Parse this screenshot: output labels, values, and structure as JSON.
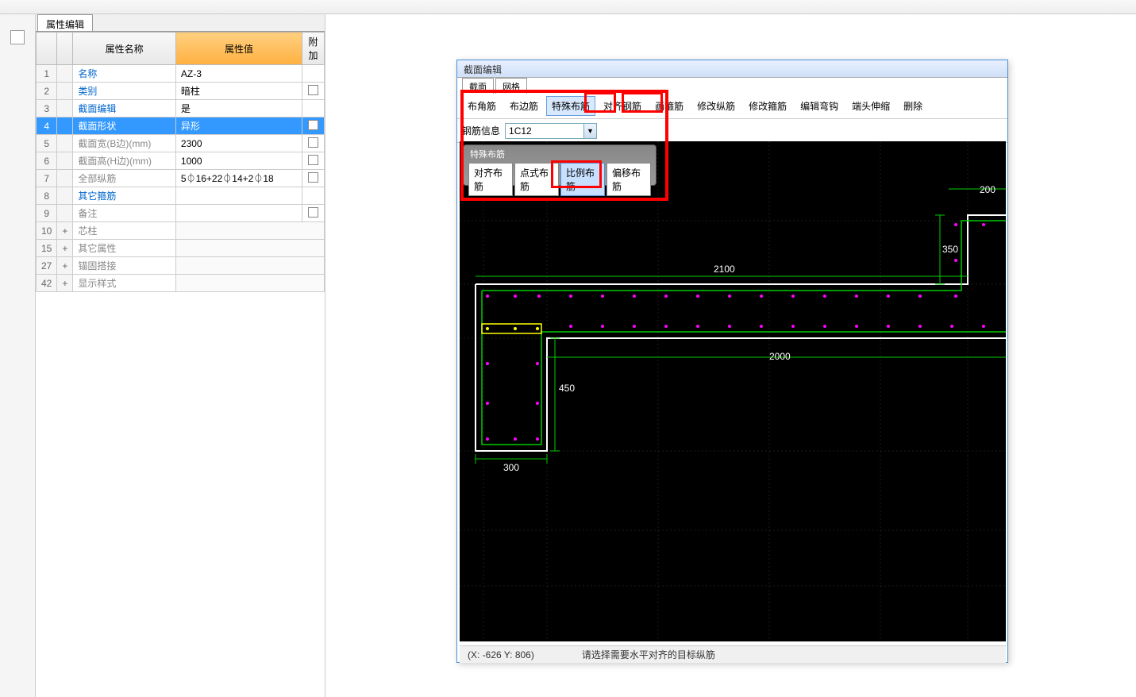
{
  "panel_tab": "属性编辑",
  "columns": {
    "name": "属性名称",
    "value": "属性值",
    "extra": "附加"
  },
  "rows": [
    {
      "num": "1",
      "name": "名称",
      "value": "AZ-3",
      "cls": "name",
      "check": false
    },
    {
      "num": "2",
      "name": "类别",
      "value": "暗柱",
      "cls": "name",
      "check": true
    },
    {
      "num": "3",
      "name": "截面编辑",
      "value": "是",
      "cls": "name",
      "check": false
    },
    {
      "num": "4",
      "name": "截面形状",
      "value": "异形",
      "cls": "name",
      "check": true,
      "selected": true
    },
    {
      "num": "5",
      "name": "截面宽(B边)(mm)",
      "value": "2300",
      "cls": "name-gray",
      "check": true
    },
    {
      "num": "6",
      "name": "截面高(H边)(mm)",
      "value": "1000",
      "cls": "name-gray",
      "check": true
    },
    {
      "num": "7",
      "name": "全部纵筋",
      "value": "5⏀16+22⏀14+2⏀18",
      "cls": "name-gray",
      "check": true
    },
    {
      "num": "8",
      "name": "其它箍筋",
      "value": "",
      "cls": "name",
      "check": false
    },
    {
      "num": "9",
      "name": "备注",
      "value": "",
      "cls": "name-gray",
      "check": true
    },
    {
      "num": "10",
      "name": "芯柱",
      "value": "",
      "cls": "name-gray",
      "expand": true
    },
    {
      "num": "15",
      "name": "其它属性",
      "value": "",
      "cls": "name-gray",
      "expand": true
    },
    {
      "num": "27",
      "name": "锚固搭接",
      "value": "",
      "cls": "name-gray",
      "expand": true
    },
    {
      "num": "42",
      "name": "显示样式",
      "value": "",
      "cls": "name-gray",
      "expand": true
    }
  ],
  "editor": {
    "title": "截面编辑",
    "tabs": [
      "截面",
      "网格"
    ],
    "toolbar": [
      "布角筋",
      "布边筋",
      "特殊布筋",
      "对齐钢筋",
      "画箍筋",
      "修改纵筋",
      "修改箍筋",
      "编辑弯钩",
      "端头伸缩",
      "删除"
    ],
    "toolbar_active_index": 2,
    "rebar_info_label": "钢筋信息",
    "rebar_info_value": "1C12",
    "sub_title": "特殊布筋",
    "sub_buttons": [
      "对齐布筋",
      "点式布筋",
      "比例布筋",
      "偏移布筋"
    ],
    "sub_active_index": 2,
    "dimensions": {
      "w_top": "2100",
      "w_bottom": "2000",
      "h_left": "450",
      "h_right": "350",
      "bottom_w": "300",
      "right_top": "200"
    },
    "status_coords": "(X: -626 Y: 806)",
    "status_hint": "请选择需要水平对齐的目标纵筋"
  }
}
